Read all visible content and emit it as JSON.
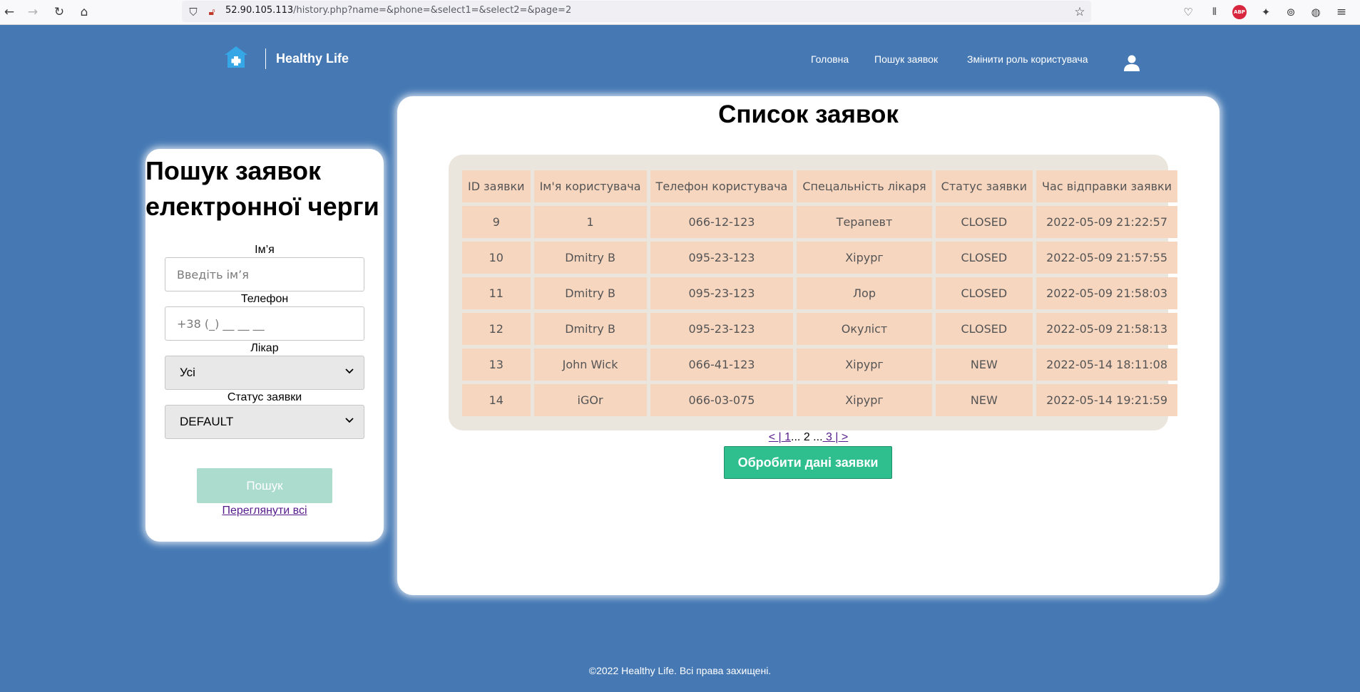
{
  "browser": {
    "url_host": "52.90.105.113",
    "url_path": "/history.php?name=&phone=&select1=&select2=&page=2",
    "adblock_label": "ABP"
  },
  "header": {
    "site_name": "Healthy Life",
    "nav": [
      "Головна",
      "Пошук заявок",
      "Змінити роль користувача"
    ]
  },
  "search": {
    "title": "Пошук заявок електронної черги",
    "name_label": "Ім’я",
    "name_placeholder": "Введіть ім’я",
    "phone_label": "Телефон",
    "phone_placeholder": "+38 (_) __ __ __",
    "doctor_label": "Лікар",
    "doctor_value": "Усі",
    "status_label": "Статус заявки",
    "status_value": "DEFAULT",
    "search_button": "Пошук",
    "view_all_link": "Переглянути всі"
  },
  "list": {
    "title": "Список заявок",
    "columns": [
      "ID заявки",
      "Ім'я користувача",
      "Телефон користувача",
      "Спецальність лікаря",
      "Статус заявки",
      "Час відправки заявки"
    ],
    "rows": [
      [
        "9",
        "1",
        "066-12-123",
        "Терапевт",
        "CLOSED",
        "2022-05-09 21:22:57"
      ],
      [
        "10",
        "Dmitry B",
        "095-23-123",
        "Хірург",
        "CLOSED",
        "2022-05-09 21:57:55"
      ],
      [
        "11",
        "Dmitry B",
        "095-23-123",
        "Лор",
        "CLOSED",
        "2022-05-09 21:58:03"
      ],
      [
        "12",
        "Dmitry B",
        "095-23-123",
        "Окуліст",
        "CLOSED",
        "2022-05-09 21:58:13"
      ],
      [
        "13",
        "John Wick",
        "066-41-123",
        "Хірург",
        "NEW",
        "2022-05-14 18:11:08"
      ],
      [
        "14",
        "iGOr",
        "066-03-075",
        "Хірург",
        "NEW",
        "2022-05-14 19:21:59"
      ]
    ],
    "pagination": {
      "prev": "< |",
      "first": " 1",
      "ellipsis1": "...",
      "current": " 2 ",
      "ellipsis2": "...",
      "last": " 3 |",
      "next": " >"
    },
    "process_button": "Обробити дані заявки"
  },
  "footer": "©2022 Healthy Life. Всі права захищені.",
  "colors": {
    "page_background": "#4679b4",
    "table_cell": "#f7d6c0",
    "table_container": "#ebe6dd",
    "process_button": "#2fbf8f",
    "search_button": "#acdccd"
  }
}
